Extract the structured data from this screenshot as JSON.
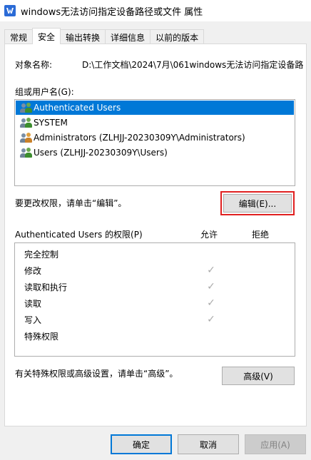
{
  "window": {
    "title": "windows无法访问指定设备路径或文件 属性",
    "icon": "word-doc-icon"
  },
  "tabs": [
    {
      "label": "常规",
      "active": false
    },
    {
      "label": "安全",
      "active": true
    },
    {
      "label": "输出转换",
      "active": false
    },
    {
      "label": "详细信息",
      "active": false
    },
    {
      "label": "以前的版本",
      "active": false
    }
  ],
  "security": {
    "object_label": "对象名称:",
    "object_value": "D:\\工作文档\\2024\\7月\\061windows无法访问指定设备路",
    "group_label": "组或用户名(G):",
    "users": [
      {
        "name": "Authenticated Users",
        "icon": "users-icon",
        "selected": true
      },
      {
        "name": "SYSTEM",
        "icon": "users-icon",
        "selected": false
      },
      {
        "name": "Administrators (ZLHJJ-20230309Y\\Administrators)",
        "icon": "users-icon",
        "selected": false
      },
      {
        "name": "Users (ZLHJJ-20230309Y\\Users)",
        "icon": "users-icon",
        "selected": false
      }
    ],
    "change_note": "要更改权限，请单击“编辑”。",
    "edit_button": "编辑(E)...",
    "perm_header": "Authenticated Users 的权限(P)",
    "allow_label": "允许",
    "deny_label": "拒绝",
    "permissions": [
      {
        "name": "完全控制",
        "allow": false,
        "deny": false
      },
      {
        "name": "修改",
        "allow": true,
        "deny": false
      },
      {
        "name": "读取和执行",
        "allow": true,
        "deny": false
      },
      {
        "name": "读取",
        "allow": true,
        "deny": false
      },
      {
        "name": "写入",
        "allow": true,
        "deny": false
      },
      {
        "name": "特殊权限",
        "allow": false,
        "deny": false
      }
    ],
    "check_glyph": "✓",
    "advanced_note": "有关特殊权限或高级设置，请单击“高级”。",
    "advanced_button": "高级(V)"
  },
  "footer": {
    "ok": "确定",
    "cancel": "取消",
    "apply": "应用(A)"
  },
  "colors": {
    "selection": "#0078d7",
    "highlight_box": "#e02020"
  }
}
